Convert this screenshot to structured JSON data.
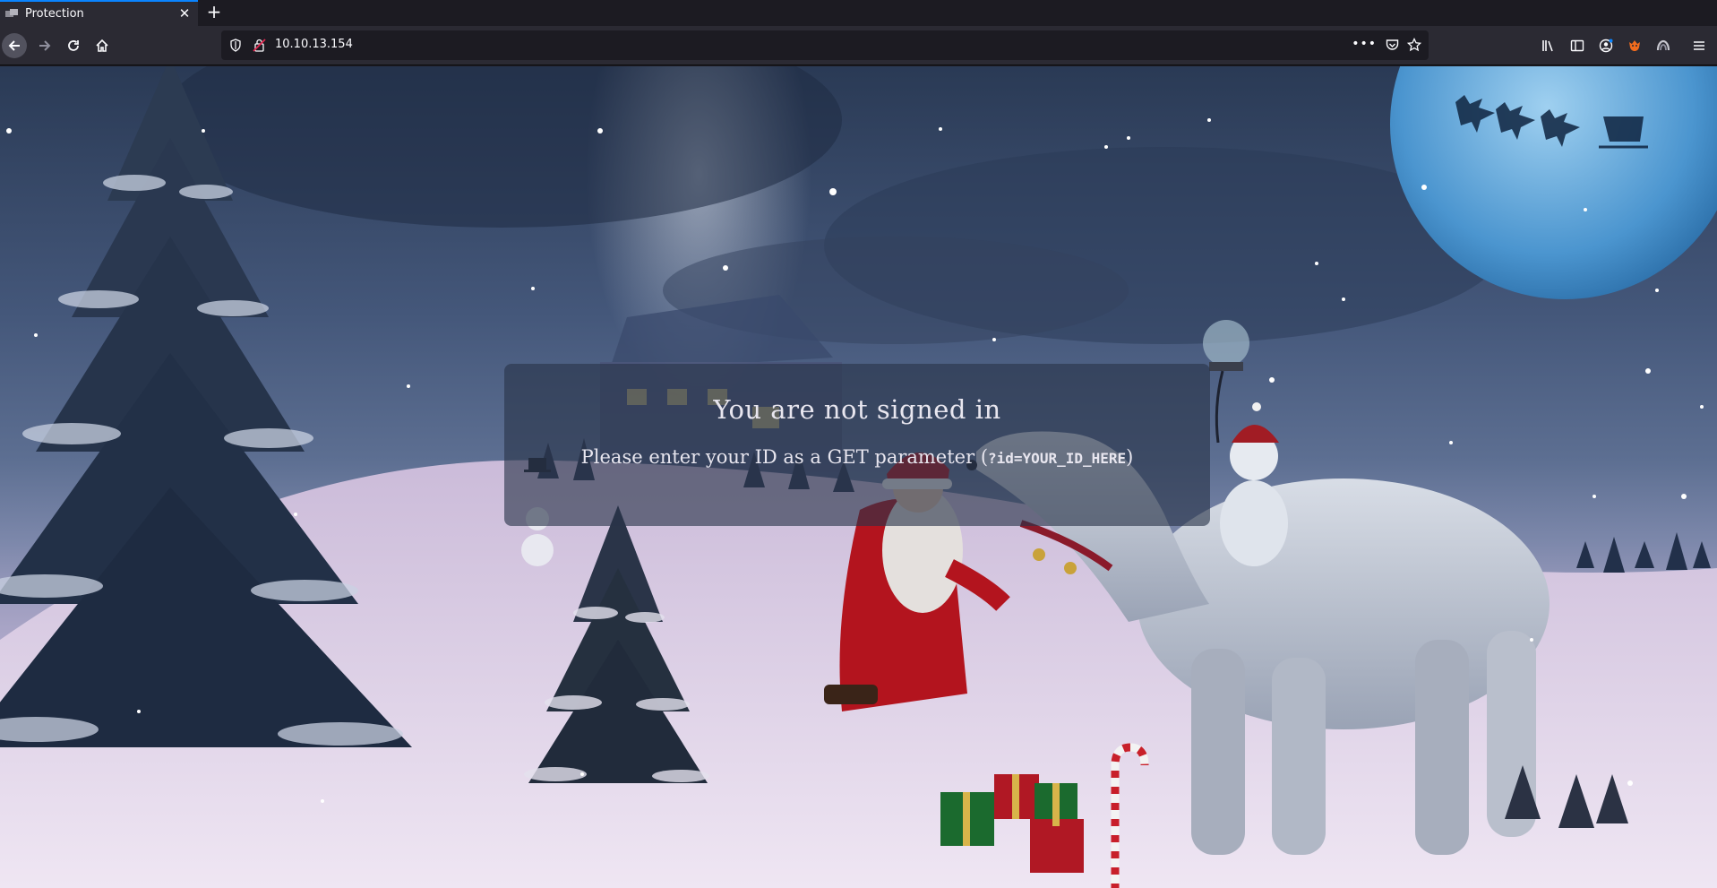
{
  "browser": {
    "tab": {
      "title": "Protection"
    },
    "url": "10.10.13.154"
  },
  "page": {
    "heading": "You are not signed in",
    "instruction_prefix": "Please enter your ID as a GET parameter (",
    "instruction_code": "?id=YOUR_ID_HERE",
    "instruction_suffix": ")"
  },
  "colors": {
    "accent_tab": "#0a84ff",
    "chrome_bg": "#2b2a33",
    "card_bg": "rgba(40,52,72,0.62)"
  }
}
